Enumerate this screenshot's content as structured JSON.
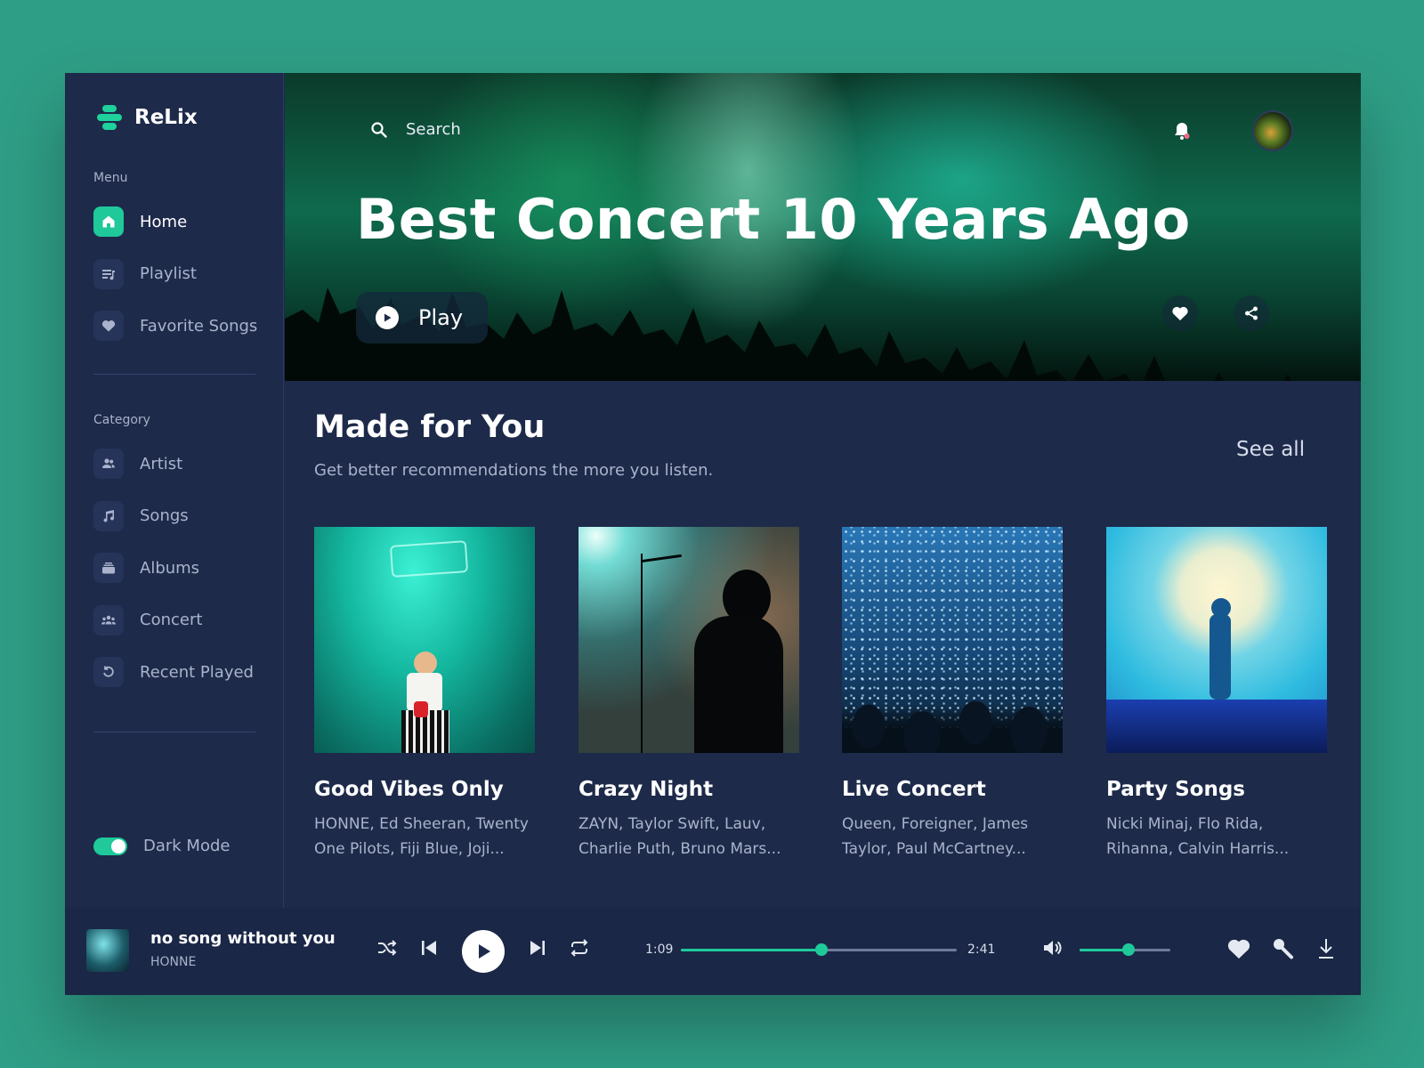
{
  "app": {
    "name": "ReLix"
  },
  "sidebar": {
    "menu_heading": "Menu",
    "menu_items": [
      {
        "label": "Home",
        "icon": "home-icon",
        "active": true
      },
      {
        "label": "Playlist",
        "icon": "playlist-icon",
        "active": false
      },
      {
        "label": "Favorite Songs",
        "icon": "heart-icon",
        "active": false
      }
    ],
    "category_heading": "Category",
    "category_items": [
      {
        "label": "Artist",
        "icon": "users-icon"
      },
      {
        "label": "Songs",
        "icon": "music-note-icon"
      },
      {
        "label": "Albums",
        "icon": "album-icon"
      },
      {
        "label": "Concert",
        "icon": "crowd-icon"
      },
      {
        "label": "Recent Played",
        "icon": "history-icon"
      }
    ],
    "dark_mode_label": "Dark Mode",
    "dark_mode_on": true
  },
  "hero": {
    "search_placeholder": "Search",
    "title": "Best Concert 10 Years Ago",
    "play_label": "Play"
  },
  "section": {
    "title": "Made for You",
    "subtitle": "Get better recommendations the more you listen.",
    "see_all": "See all"
  },
  "cards": [
    {
      "title": "Good Vibes Only",
      "desc": "HONNE, Ed Sheeran, Twenty One Pilots, Fiji Blue, Joji..."
    },
    {
      "title": "Crazy Night",
      "desc": "ZAYN, Taylor Swift, Lauv, Charlie Puth, Bruno Mars..."
    },
    {
      "title": "Live Concert",
      "desc": "Queen, Foreigner, James Taylor, Paul McCartney..."
    },
    {
      "title": "Party Songs",
      "desc": "Nicki Minaj, Flo Rida, Rihanna, Calvin Harris..."
    }
  ],
  "player": {
    "song_title": "no song without you",
    "artist": "HONNE",
    "elapsed": "1:09",
    "duration": "2:41",
    "progress": 0.51,
    "volume": 0.54
  },
  "colors": {
    "accent": "#1fc99a",
    "panel": "#1d2a4a",
    "background": "#2f9e86"
  }
}
